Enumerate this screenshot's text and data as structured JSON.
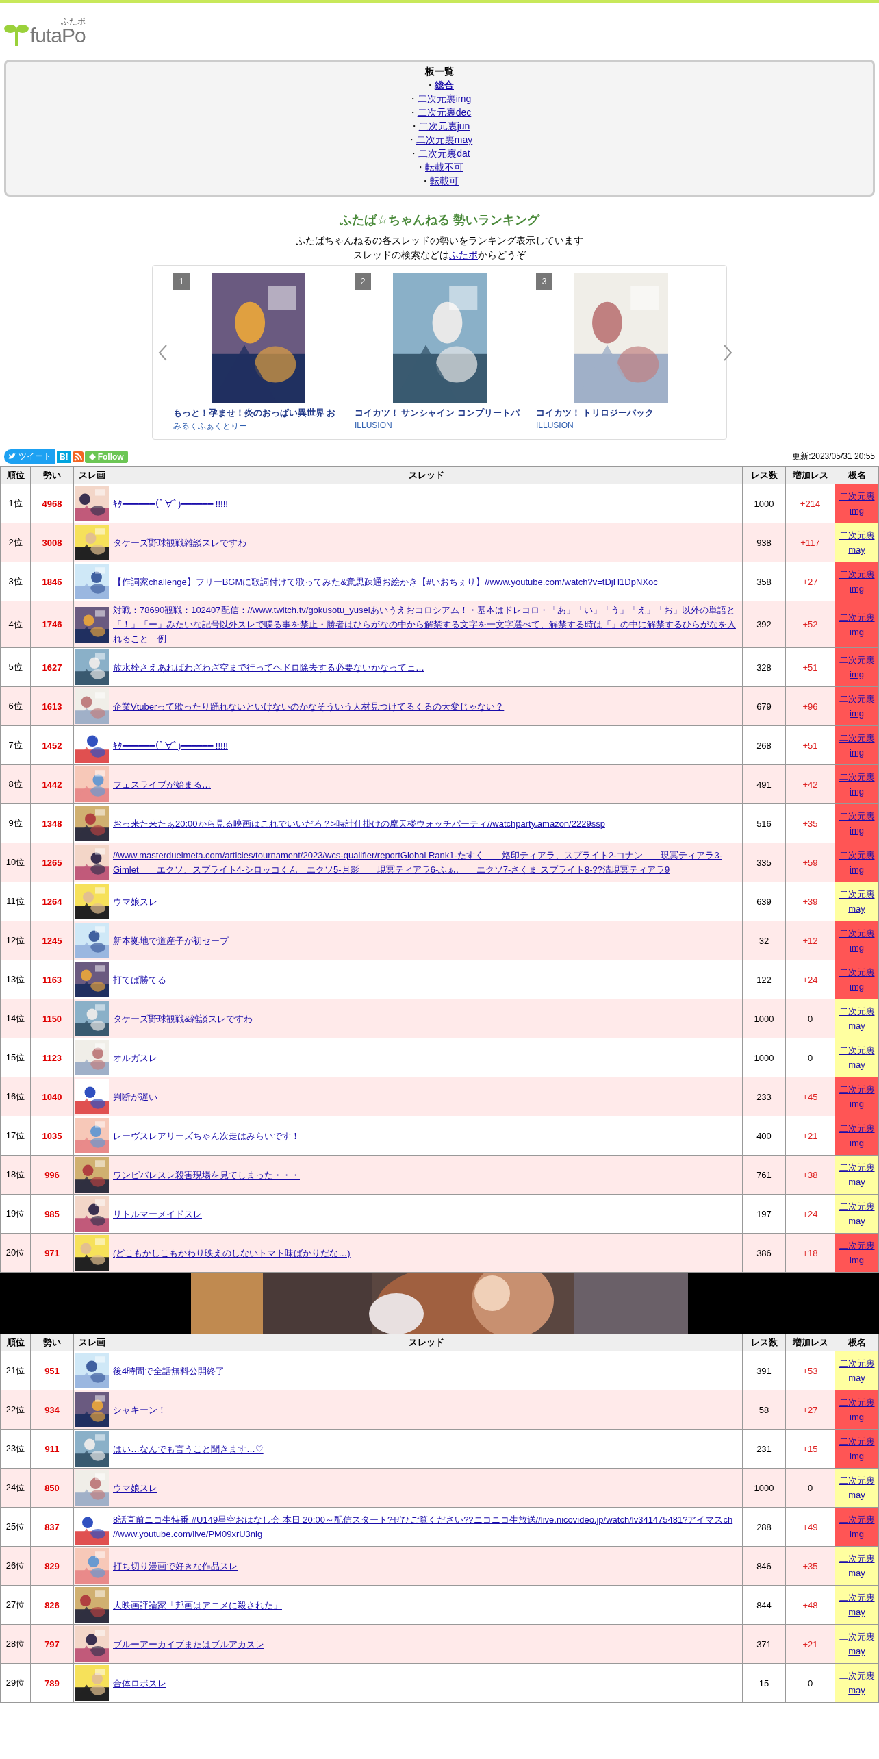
{
  "logo": {
    "wordmark": "futaPo",
    "ruby": "ふたポ"
  },
  "board_list": {
    "title": "板一覧",
    "items": [
      {
        "bullet": "・",
        "label": "総合",
        "selected": true
      },
      {
        "bullet": "・",
        "label": "二次元裏img",
        "selected": false
      },
      {
        "bullet": "・",
        "label": "二次元裏dec",
        "selected": false
      },
      {
        "bullet": "・",
        "label": "二次元裏jun",
        "selected": false
      },
      {
        "bullet": "・",
        "label": "二次元裏may",
        "selected": false
      },
      {
        "bullet": "・",
        "label": "二次元裏dat",
        "selected": false
      },
      {
        "bullet": "・",
        "label": "転載不可",
        "selected": false
      },
      {
        "bullet": "・",
        "label": "転載可",
        "selected": false
      }
    ]
  },
  "heading": "ふたば☆ちゃんねる 勢いランキング",
  "description": "ふたばちゃんねるの各スレッドの勢いをランキング表示しています",
  "search_note": {
    "before": "スレッドの検索などは",
    "link": "ふたポ",
    "after": "からどうぞ"
  },
  "carousel": [
    {
      "rank": "1",
      "title": "もっと！孕ませ！炎のおっぱい異世界 お",
      "maker": "みるくふぁくとりー"
    },
    {
      "rank": "2",
      "title": "コイカツ！ サンシャイン コンプリートパ",
      "maker": "ILLUSION"
    },
    {
      "rank": "3",
      "title": "コイカツ！ トリロジーパック",
      "maker": "ILLUSION"
    }
  ],
  "share": {
    "tweet": "ツイート",
    "hatena": "B!",
    "follow": "Follow"
  },
  "updated": "更新:2023/05/31 20:55",
  "ranking": [
    {
      "columns": [
        "順位",
        "勢い",
        "スレ画",
        "スレッド",
        "レス数",
        "増加レス",
        "板名"
      ],
      "rows": [
        {
          "rank": "1位",
          "momentum": "4968",
          "title": "ｷﾀ━━━━━━(ﾟ∀ﾟ)━━━━━━ !!!!!",
          "replies": "1000",
          "gain": "+214",
          "gain_up": true,
          "board": "二次元裏img",
          "color": "#ff5555"
        },
        {
          "rank": "2位",
          "momentum": "3008",
          "title": "タケーズ野球観戦雑談スレですわ",
          "replies": "938",
          "gain": "+117",
          "gain_up": true,
          "board": "二次元裏may",
          "color": "#ffffa0"
        },
        {
          "rank": "3位",
          "momentum": "1846",
          "title": "【作詞家challenge】フリーBGMに歌詞付けて歌ってみた&意思疎通お絵かき【#いおちぇり】//www.youtube.com/watch?v=tDjH1DpNXoc",
          "replies": "358",
          "gain": "+27",
          "gain_up": true,
          "board": "二次元裏img",
          "color": "#ff5555"
        },
        {
          "rank": "4位",
          "momentum": "1746",
          "title": "対戦：78690観戦：102407配信：//www.twitch.tv/gokusotu_yuseiあいうえおコロシアム！・基本はドレコロ・「あ」「い」「う」「え」「お」以外の単語と「！」「ー」みたいな記号以外スレで喋る事を禁止・勝者はひらがなの中から解禁する文字を一文字選べて、解禁する時は「」の中に解禁するひらがなを入れること　例",
          "replies": "392",
          "gain": "+52",
          "gain_up": true,
          "board": "二次元裏img",
          "color": "#ff5555"
        },
        {
          "rank": "5位",
          "momentum": "1627",
          "title": "放水栓さえあればわざわざ空まで行ってヘドロ除去する必要ないかなってェ…",
          "replies": "328",
          "gain": "+51",
          "gain_up": true,
          "board": "二次元裏img",
          "color": "#ff5555"
        },
        {
          "rank": "6位",
          "momentum": "1613",
          "title": "企業Vtuberって歌ったり踊れないといけないのかなそういう人材見つけてるくるの大変じゃない？",
          "replies": "679",
          "gain": "+96",
          "gain_up": true,
          "board": "二次元裏img",
          "color": "#ff5555"
        },
        {
          "rank": "7位",
          "momentum": "1452",
          "title": "ｷﾀ━━━━━━(ﾟ∀ﾟ)━━━━━━ !!!!!",
          "replies": "268",
          "gain": "+51",
          "gain_up": true,
          "board": "二次元裏img",
          "color": "#ff5555"
        },
        {
          "rank": "8位",
          "momentum": "1442",
          "title": "フェスライブが始まる…",
          "replies": "491",
          "gain": "+42",
          "gain_up": true,
          "board": "二次元裏img",
          "color": "#ff5555"
        },
        {
          "rank": "9位",
          "momentum": "1348",
          "title": "おっ来た来たぁ20:00から見る映画はこれでいいだろ？>時計仕掛けの摩天楼ウォッチパーティ//watchparty.amazon/2229ssp",
          "replies": "516",
          "gain": "+35",
          "gain_up": true,
          "board": "二次元裏img",
          "color": "#ff5555"
        },
        {
          "rank": "10位",
          "momentum": "1265",
          "title": "//www.masterduelmeta.com/articles/tournament/2023/wcs-qualifier/reportGlobal Rank1-たすく　　烙印ティアラ、スプライト2-コナン　　現冥ティアラ3-Gimlet　　エクソ、スプライト4-シロッコくん　エクソ5-月影　　現冥ティアラ6-ふぁ.　　エクソ7-さくま スプライト8-??清現冥ティアラ9",
          "replies": "335",
          "gain": "+59",
          "gain_up": true,
          "board": "二次元裏img",
          "color": "#ff5555"
        },
        {
          "rank": "11位",
          "momentum": "1264",
          "title": "ウマ娘スレ",
          "replies": "639",
          "gain": "+39",
          "gain_up": true,
          "board": "二次元裏may",
          "color": "#ffffa0"
        },
        {
          "rank": "12位",
          "momentum": "1245",
          "title": "新本拠地で道産子が初セーブ",
          "replies": "32",
          "gain": "+12",
          "gain_up": true,
          "board": "二次元裏img",
          "color": "#ff5555"
        },
        {
          "rank": "13位",
          "momentum": "1163",
          "title": "打てば勝てる",
          "replies": "122",
          "gain": "+24",
          "gain_up": true,
          "board": "二次元裏img",
          "color": "#ff5555"
        },
        {
          "rank": "14位",
          "momentum": "1150",
          "title": "タケーズ野球観戦&雑談スレですわ",
          "replies": "1000",
          "gain": "0",
          "gain_up": false,
          "board": "二次元裏may",
          "color": "#ffffa0"
        },
        {
          "rank": "15位",
          "momentum": "1123",
          "title": "オルガスレ",
          "replies": "1000",
          "gain": "0",
          "gain_up": false,
          "board": "二次元裏may",
          "color": "#ffffa0"
        },
        {
          "rank": "16位",
          "momentum": "1040",
          "title": "判断が遅い",
          "replies": "233",
          "gain": "+45",
          "gain_up": true,
          "board": "二次元裏img",
          "color": "#ff5555"
        },
        {
          "rank": "17位",
          "momentum": "1035",
          "title": "レーヴスレアリーズちゃん次走はみらいです！",
          "replies": "400",
          "gain": "+21",
          "gain_up": true,
          "board": "二次元裏img",
          "color": "#ff5555"
        },
        {
          "rank": "18位",
          "momentum": "996",
          "title": "ワンピバレスレ殺害現場を見てしまった・・・",
          "replies": "761",
          "gain": "+38",
          "gain_up": true,
          "board": "二次元裏may",
          "color": "#ffffa0"
        },
        {
          "rank": "19位",
          "momentum": "985",
          "title": "リトルマーメイドスレ",
          "replies": "197",
          "gain": "+24",
          "gain_up": true,
          "board": "二次元裏may",
          "color": "#ffffa0"
        },
        {
          "rank": "20位",
          "momentum": "971",
          "title": "(どこもかしこもかわり映えのしないトマト味ばかりだな…)",
          "replies": "386",
          "gain": "+18",
          "gain_up": true,
          "board": "二次元裏img",
          "color": "#ff5555"
        }
      ]
    },
    {
      "columns": [
        "順位",
        "勢い",
        "スレ画",
        "スレッド",
        "レス数",
        "増加レス",
        "板名"
      ],
      "rows": [
        {
          "rank": "21位",
          "momentum": "951",
          "title": "後4時間で全話無料公開終了",
          "replies": "391",
          "gain": "+53",
          "gain_up": true,
          "board": "二次元裏may",
          "color": "#ffffa0"
        },
        {
          "rank": "22位",
          "momentum": "934",
          "title": "シャキーン！",
          "replies": "58",
          "gain": "+27",
          "gain_up": true,
          "board": "二次元裏img",
          "color": "#ff5555"
        },
        {
          "rank": "23位",
          "momentum": "911",
          "title": "はい…なんでも言うこと聞きます…♡",
          "replies": "231",
          "gain": "+15",
          "gain_up": true,
          "board": "二次元裏img",
          "color": "#ff5555"
        },
        {
          "rank": "24位",
          "momentum": "850",
          "title": "ウマ娘スレ",
          "replies": "1000",
          "gain": "0",
          "gain_up": false,
          "board": "二次元裏may",
          "color": "#ffffa0"
        },
        {
          "rank": "25位",
          "momentum": "837",
          "title": "8話直前ニコ生特番 #U149星空おはなし会 本日 20:00～配信スタート?ぜひご覧ください??ニコニコ生放送//live.nicovideo.jp/watch/lv341475481?アイマスch //www.youtube.com/live/PM09xrU3nig",
          "replies": "288",
          "gain": "+49",
          "gain_up": true,
          "board": "二次元裏img",
          "color": "#ff5555"
        },
        {
          "rank": "26位",
          "momentum": "829",
          "title": "打ち切り漫画で好きな作品スレ",
          "replies": "846",
          "gain": "+35",
          "gain_up": true,
          "board": "二次元裏may",
          "color": "#ffffa0"
        },
        {
          "rank": "27位",
          "momentum": "826",
          "title": "大映画評論家「邦画はアニメに殺された」",
          "replies": "844",
          "gain": "+48",
          "gain_up": true,
          "board": "二次元裏may",
          "color": "#ffffa0"
        },
        {
          "rank": "28位",
          "momentum": "797",
          "title": "ブルーアーカイブまたはブルアカスレ",
          "replies": "371",
          "gain": "+21",
          "gain_up": true,
          "board": "二次元裏may",
          "color": "#ffffa0"
        },
        {
          "rank": "29位",
          "momentum": "789",
          "title": "合体ロボスレ",
          "replies": "15",
          "gain": "0",
          "gain_up": false,
          "board": "二次元裏may",
          "color": "#ffffa0"
        }
      ]
    }
  ]
}
